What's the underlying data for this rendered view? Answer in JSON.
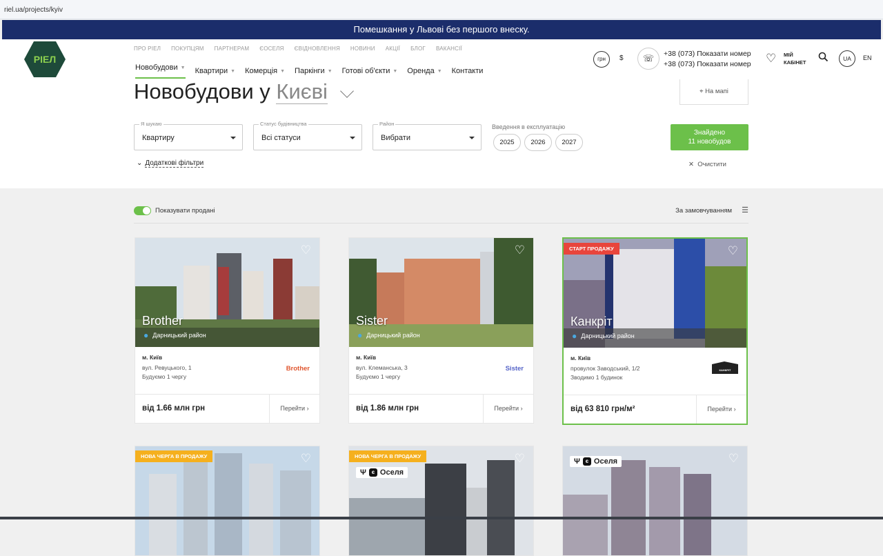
{
  "browser": {
    "url": "riel.ua/projects/kyiv"
  },
  "promo": {
    "text": "Помешкання у Львові без першого внеску."
  },
  "header": {
    "logo_text": "РІЕЛ",
    "top_nav": [
      "ПРО РІЕЛ",
      "ПОКУПЦЯМ",
      "ПАРТНЕРАМ",
      "ЄОСЕЛЯ",
      "ЄВІДНОВЛЕННЯ",
      "НОВИНИ",
      "АКЦІЇ",
      "БЛОГ",
      "ВАКАНСІЇ"
    ],
    "main_nav": [
      {
        "label": "Новобудови",
        "dropdown": true
      },
      {
        "label": "Квартири",
        "dropdown": true
      },
      {
        "label": "Комерція",
        "dropdown": true
      },
      {
        "label": "Паркінги",
        "dropdown": true
      },
      {
        "label": "Готові об'єкти",
        "dropdown": true
      },
      {
        "label": "Оренда",
        "dropdown": true
      },
      {
        "label": "Контакти",
        "dropdown": false
      }
    ],
    "currency_uah": "грн",
    "currency_usd": "$",
    "phone_1": "+38 (073) Показати номер",
    "phone_2": "+38 (073) Показати номер",
    "cabinet_line1": "МІЙ",
    "cabinet_line2": "КАБІНЕТ",
    "lang_active": "UA",
    "lang_other": "EN"
  },
  "filters": {
    "title_prefix": "Новобудови у",
    "title_city": "Києві",
    "map_button": "На мапі",
    "search_label": "Я шукаю",
    "search_value": "Квартиру",
    "status_label": "Статус будівництва",
    "status_value": "Всі статуси",
    "district_label": "Район",
    "district_value": "Вибрати",
    "commissioning_label": "Введення в експлуатацію",
    "years": [
      "2025",
      "2026",
      "2027"
    ],
    "found_line1": "Знайдено",
    "found_line2": "11 новобудов",
    "extra_filters": "Додаткові фільтри",
    "clear": "Очистити"
  },
  "toolbar": {
    "show_sold": "Показувати продані",
    "sort": "За замовчуванням"
  },
  "colors": {
    "accent": "#6cc04a",
    "promo_bg": "#1b2d6b",
    "badge_red": "#e8453c",
    "badge_yellow": "#f5b01e",
    "pin": "#4aa8e0"
  },
  "cards": [
    {
      "name": "Brother",
      "district": "Дарницький район",
      "city": "м. Київ",
      "address": "вул. Ревуцького, 1",
      "stage": "Будуємо 1 чергу",
      "brand": "Brother",
      "price": "від 1.66 млн грн",
      "go": "Перейти"
    },
    {
      "name": "Sister",
      "district": "Дарницький район",
      "city": "м. Київ",
      "address": "вул. Клеманська, 3",
      "stage": "Будуємо 1 чергу",
      "brand": "Sister",
      "price": "від 1.86 млн грн",
      "go": "Перейти"
    },
    {
      "name": "Канкріт",
      "badge": "СТАРТ ПРОДАЖУ",
      "district": "Дарницький район",
      "city": "м. Київ",
      "address": "провулок Заводський, 1/2",
      "stage": "Зводимо 1 будинок",
      "brand": "КАНКРІТ",
      "price": "від 63 810 грн/м²",
      "go": "Перейти"
    },
    {
      "badge": "НОВА ЧЕРГА В ПРОДАЖУ"
    },
    {
      "badge": "НОВА ЧЕРГА В ПРОДАЖУ",
      "oselya": "Оселя"
    },
    {
      "oselya": "Оселя"
    }
  ]
}
